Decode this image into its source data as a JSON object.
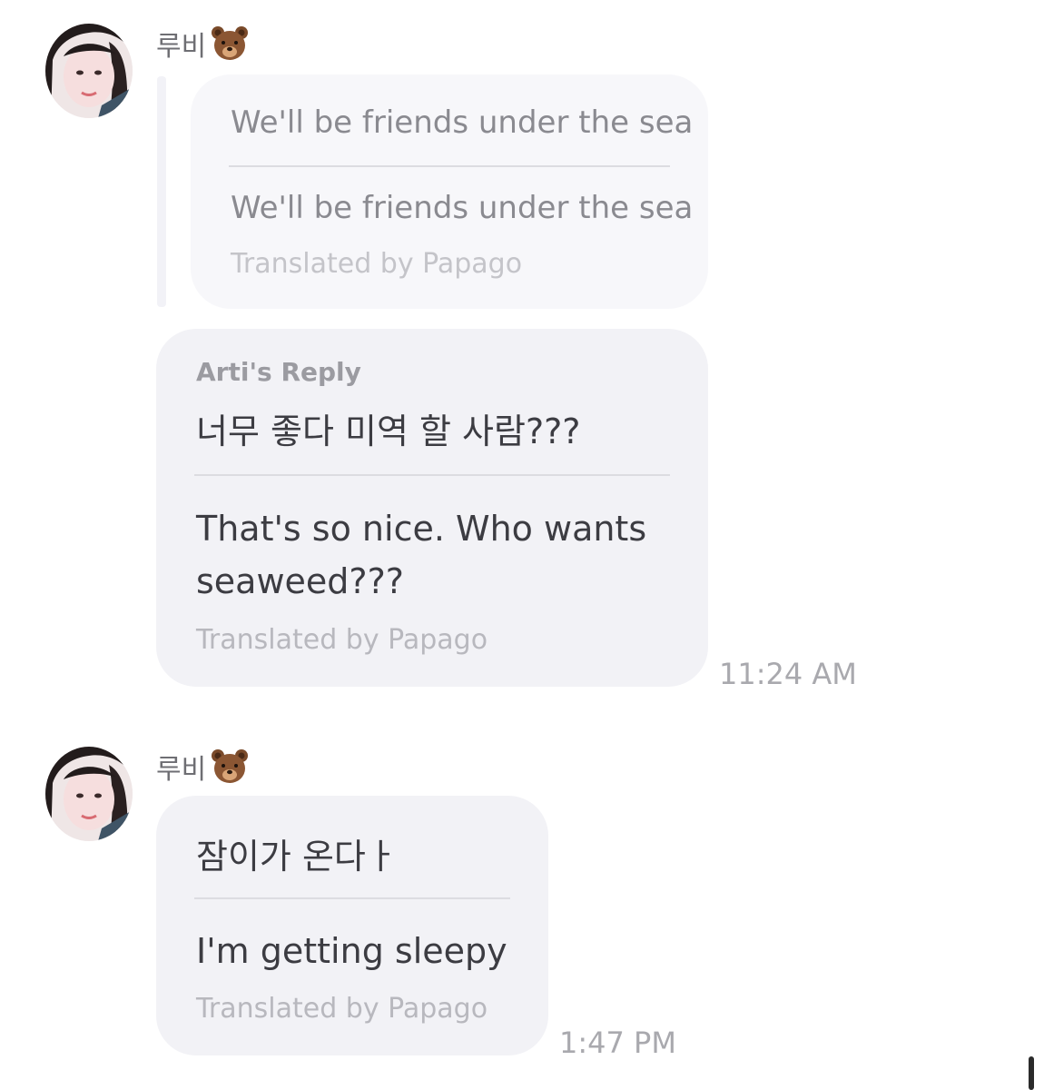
{
  "messages": [
    {
      "sender": "루비",
      "sender_emoji": "bear-face-emoji",
      "quoted": {
        "original": "We'll be friends under the sea",
        "translation": "We'll be friends under the sea",
        "credit": "Translated by Papago"
      },
      "reply_label": "Arti's Reply",
      "original": "너무 좋다 미역 할 사람???",
      "translation": "That's so nice. Who wants seaweed???",
      "credit": "Translated by Papago",
      "time": "11:24 AM"
    },
    {
      "sender": "루비",
      "sender_emoji": "bear-face-emoji",
      "original": "잠이가 온다ㅏ",
      "translation": "I'm getting sleepy",
      "credit": "Translated by Papago",
      "time": "1:47 PM"
    }
  ],
  "colors": {
    "bubble": "#f2f2f6",
    "quoted_bubble": "#f7f7fa",
    "text": "#3c3c42",
    "muted": "#b8b8be"
  }
}
